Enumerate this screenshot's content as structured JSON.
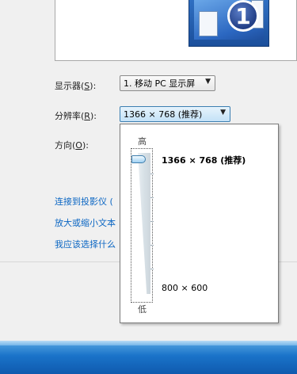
{
  "preview": {
    "monitor_number": "1"
  },
  "display_row": {
    "label": "显示器(",
    "hotkey": "S",
    "label_end": "):",
    "value": "1. 移动 PC 显示屏"
  },
  "resolution_row": {
    "label": "分辨率(",
    "hotkey": "R",
    "label_end": "):",
    "value": "1366 × 768 (推荐)"
  },
  "orientation_row": {
    "label": "方向(",
    "hotkey": "O",
    "label_end": "):"
  },
  "links": [
    "连接到投影仪 (",
    "放大或缩小文本",
    "我应该选择什么"
  ],
  "resolution_popup": {
    "high_label": "高",
    "low_label": "低",
    "top_resolution": "1366 × 768 (推荐)",
    "bottom_resolution": "800 × 600",
    "slider_position": "max"
  },
  "colors": {
    "link": "#0b66c3",
    "taskbar": "#1a73c9",
    "accent": "#3c7fb1"
  }
}
